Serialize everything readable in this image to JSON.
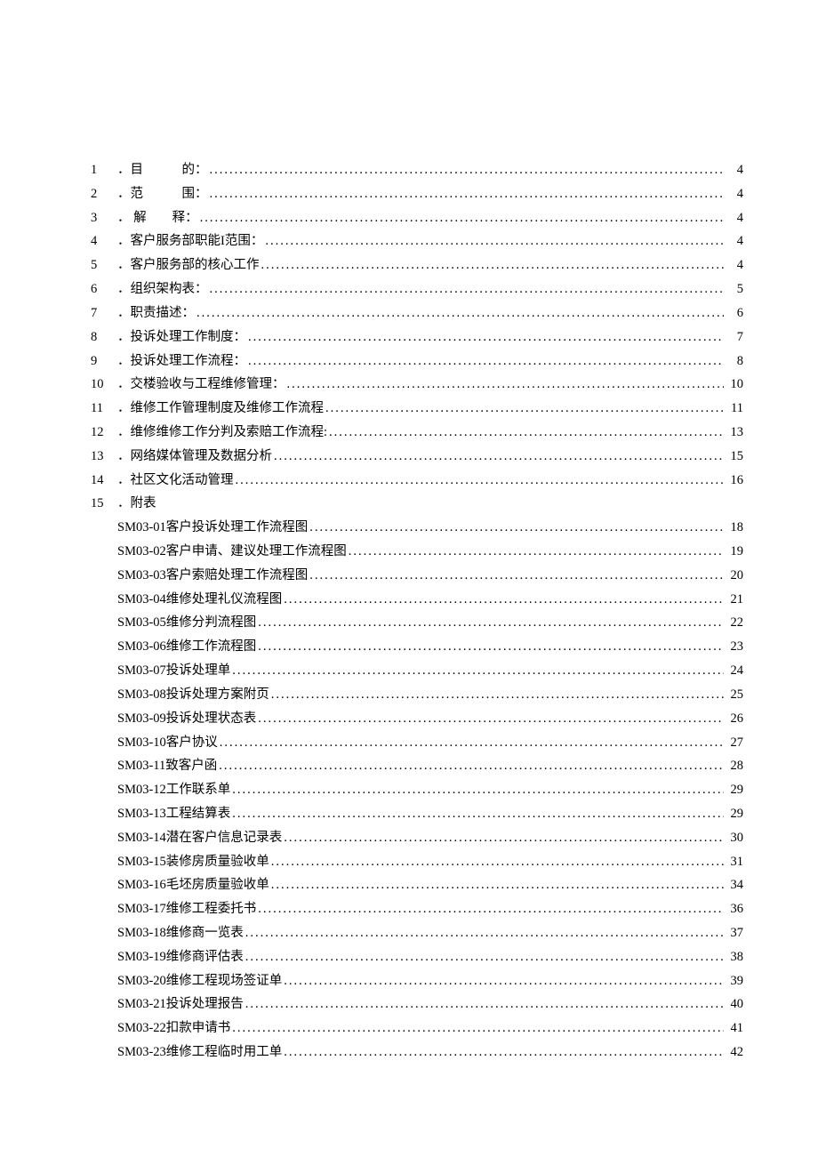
{
  "entries": [
    {
      "num": "1",
      "title": "．目　　　的：",
      "page": "4"
    },
    {
      "num": "2",
      "title": "．范　　　围：",
      "page": "4"
    },
    {
      "num": "3",
      "title": "． 解　　释：",
      "page": "4"
    },
    {
      "num": "4",
      "title": "．客户服务部职能I范围：",
      "page": "4"
    },
    {
      "num": "5",
      "title": "．客户服务部的核心工作",
      "page": "4"
    },
    {
      "num": "6",
      "title": "．组织架构表：",
      "page": "5"
    },
    {
      "num": "7",
      "title": "．职责描述：",
      "page": "6"
    },
    {
      "num": "8",
      "title": "．投诉处理工作制度：",
      "page": "7"
    },
    {
      "num": "9",
      "title": "．投诉处理工作流程：",
      "page": "8"
    },
    {
      "num": "10",
      "title": "．交楼验收与工程维修管理：",
      "page": "10"
    },
    {
      "num": "11",
      "title": "．维修工作管理制度及维修工作流程",
      "page": "11"
    },
    {
      "num": "12",
      "title": "．维修维修工作分判及索赔工作流程:",
      "page": "13"
    },
    {
      "num": "13",
      "title": "．网络媒体管理及数据分析",
      "page": "15"
    },
    {
      "num": "14",
      "title": "．社区文化活动管理",
      "page": "16"
    },
    {
      "num": "15",
      "title": "．附表",
      "page": ""
    }
  ],
  "sub_entries": [
    {
      "title": "SM03-01客户投诉处理工作流程图",
      "page": "18"
    },
    {
      "title": "SM03-02客户申请、建议处理工作流程图",
      "page": "19"
    },
    {
      "title": "SM03-03客户索赔处理工作流程图",
      "page": "20"
    },
    {
      "title": "SM03-04维修处理礼仪流程图",
      "page": "21"
    },
    {
      "title": "SM03-05维修分判流程图",
      "page": "22"
    },
    {
      "title": "SM03-06维修工作流程图",
      "page": "23"
    },
    {
      "title": "SM03-07投诉处理单",
      "page": "24"
    },
    {
      "title": "SM03-08投诉处理方案附页",
      "page": "25"
    },
    {
      "title": "SM03-09投诉处理状态表",
      "page": "26"
    },
    {
      "title": "SM03-10客户协议",
      "page": "27"
    },
    {
      "title": "SM03-11致客户函",
      "page": "28"
    },
    {
      "title": "SM03-12工作联系单",
      "page": "29"
    },
    {
      "title": "SM03-13工程结算表",
      "page": "29"
    },
    {
      "title": "SM03-14潜在客户信息记录表",
      "page": "30"
    },
    {
      "title": "SM03-15装修房质量验收单",
      "page": "31"
    },
    {
      "title": "SM03-16毛坯房质量验收单",
      "page": "34"
    },
    {
      "title": "SM03-17维修工程委托书",
      "page": "36"
    },
    {
      "title": "SM03-18维修商一览表",
      "page": "37"
    },
    {
      "title": "SM03-19维修商评估表",
      "page": "38"
    },
    {
      "title": "SM03-20维修工程现场签证单",
      "page": "39"
    },
    {
      "title": "SM03-21投诉处理报告",
      "page": "40"
    },
    {
      "title": "SM03-22扣款申请书",
      "page": "41"
    },
    {
      "title": "SM03-23维修工程临时用工单",
      "page": "42"
    }
  ]
}
